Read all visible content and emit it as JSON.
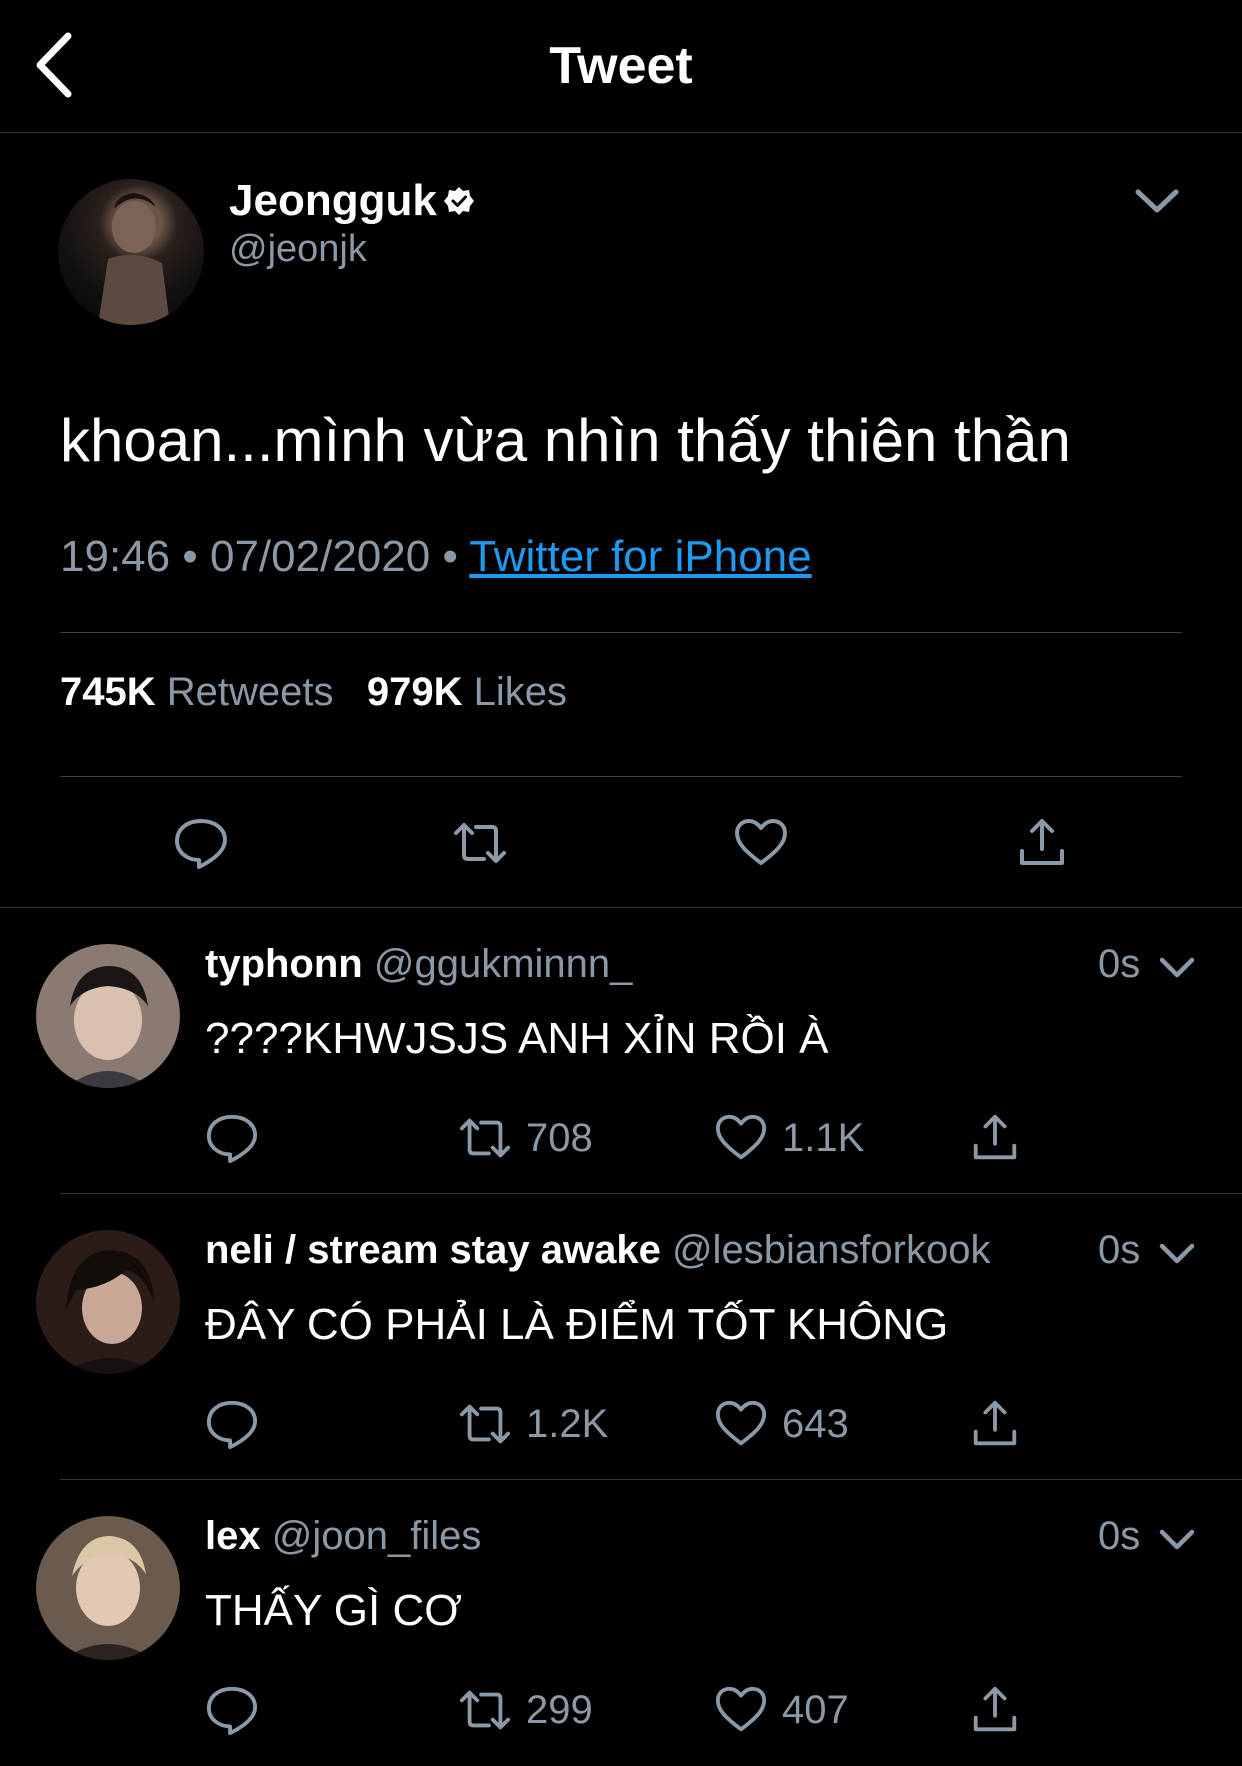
{
  "header": {
    "title": "Tweet",
    "back_icon": "chevron-left-icon"
  },
  "tweet": {
    "author_name": "Jeongguk",
    "author_handle": "@jeonjk",
    "verified": true,
    "text": "khoan...mình vừa nhìn thấy thiên thần",
    "time": "19:46",
    "date": "07/02/2020",
    "source": "Twitter for iPhone",
    "retweets_count": "745K",
    "retweets_label": "Retweets",
    "likes_count": "979K",
    "likes_label": "Likes"
  },
  "colors": {
    "background": "#000000",
    "text": "#ffffff",
    "muted": "#8b98a5",
    "link": "#1d9bf0",
    "divider": "#2f3336"
  },
  "replies": [
    {
      "name": "typhonn",
      "handle": "@ggukminnn_",
      "time": "0s",
      "text": "????KHWJSJS ANH XỈN RỒI À",
      "retweets": "708",
      "likes": "1.1K"
    },
    {
      "name": "neli / stream stay awake",
      "handle": "@lesbiansforkook",
      "time": "0s",
      "text": "ĐÂY CÓ PHẢI LÀ ĐIỂM TỐT KHÔNG",
      "retweets": "1.2K",
      "likes": "643"
    },
    {
      "name": "lex",
      "handle": "@joon_files",
      "time": "0s",
      "text": "THẤY GÌ CƠ",
      "retweets": "299",
      "likes": "407"
    }
  ]
}
